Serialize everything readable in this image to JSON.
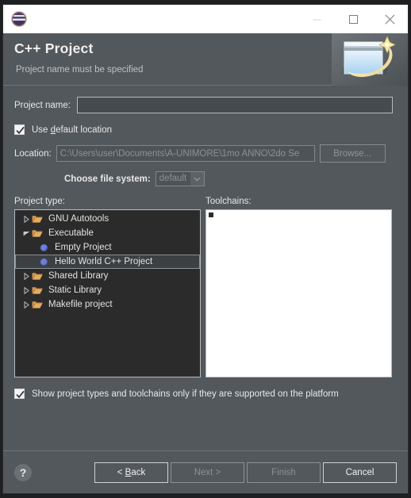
{
  "titlebar": {
    "app_icon": "eclipse-icon",
    "minimize_label": "—",
    "maximize_label": "□",
    "close_label": "✕"
  },
  "banner": {
    "title": "C++ Project",
    "subtitle": "Project name must be specified",
    "art_icon": "cpp-project-wizard-icon"
  },
  "form": {
    "project_name_label": "Project name:",
    "project_name_value": "",
    "project_name_placeholder": "",
    "use_default_location_label": "Use default location",
    "use_default_location_checked": true,
    "location_label": "Location:",
    "location_value": "C:\\Users\\user\\Documents\\A-UNIMORE\\1mo ANNO\\2do Se",
    "browse_label": "Browse...",
    "browse_enabled": false,
    "file_system_label": "Choose file system:",
    "file_system_value": "default",
    "file_system_enabled": false
  },
  "project_type": {
    "label": "Project type:",
    "nodes": [
      {
        "label": "GNU Autotools",
        "level": 1,
        "icon": "folder-icon",
        "twisty": "collapsed",
        "selected": false
      },
      {
        "label": "Executable",
        "level": 1,
        "icon": "folder-icon",
        "twisty": "expanded",
        "selected": false
      },
      {
        "label": "Empty Project",
        "level": 2,
        "icon": "bullet-icon",
        "twisty": "none",
        "selected": false
      },
      {
        "label": "Hello World C++ Project",
        "level": 2,
        "icon": "bullet-icon",
        "twisty": "none",
        "selected": true
      },
      {
        "label": "Shared Library",
        "level": 1,
        "icon": "folder-icon",
        "twisty": "collapsed",
        "selected": false
      },
      {
        "label": "Static Library",
        "level": 1,
        "icon": "folder-icon",
        "twisty": "collapsed",
        "selected": false
      },
      {
        "label": "Makefile project",
        "level": 1,
        "icon": "folder-icon",
        "twisty": "collapsed",
        "selected": false
      }
    ]
  },
  "toolchains": {
    "label": "Toolchains:",
    "items": []
  },
  "show_supported": {
    "label": "Show project types and toolchains only if they are supported on the platform",
    "checked": true
  },
  "footer": {
    "help_label": "?",
    "back_label": "< Back",
    "next_label": "Next >",
    "finish_label": "Finish",
    "cancel_label": "Cancel",
    "back_enabled": true,
    "next_enabled": false,
    "finish_enabled": false,
    "cancel_enabled": true
  },
  "colors": {
    "dialog_bg": "#53585c",
    "tree_bg": "#2b2b2b",
    "list_bg": "#ffffff",
    "titlebar_bg": "#ffffff",
    "text": "#e8e8e8",
    "subtext": "#b9c3c9",
    "folder": "#d89a4e",
    "bullet": "#6b7fe0",
    "border": "#b6bbbf",
    "disabled_text": "#8d9296"
  }
}
